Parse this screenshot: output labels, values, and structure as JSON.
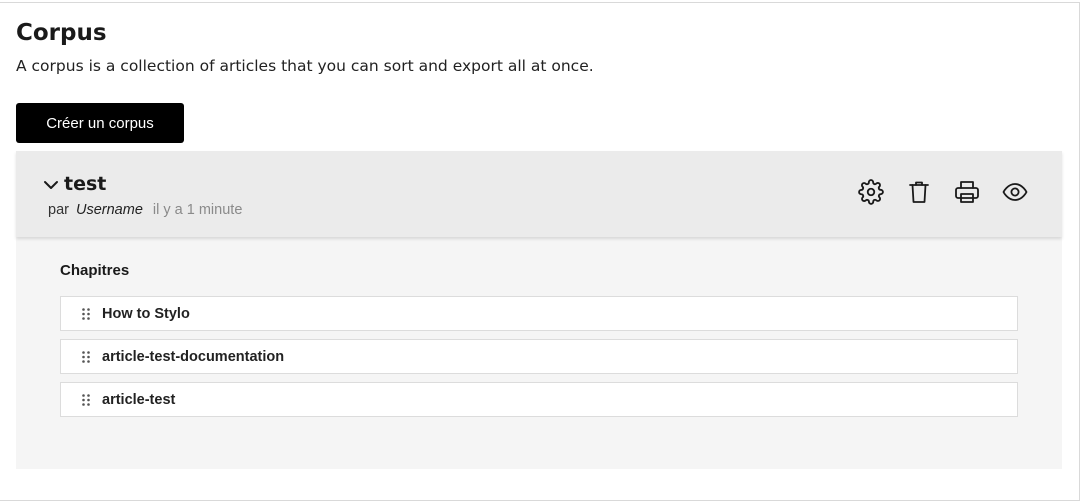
{
  "page": {
    "title": "Corpus",
    "description": "A corpus is a collection of articles that you can sort and export all at once."
  },
  "toolbar": {
    "create_label": "Créer un corpus"
  },
  "corpus": {
    "name": "test",
    "by_label": "par",
    "author": "Username",
    "updated": "il y a 1 minute",
    "actions": [
      "settings",
      "delete",
      "print",
      "preview"
    ],
    "section_title": "Chapitres",
    "chapters": [
      {
        "label": "How to Stylo"
      },
      {
        "label": "article-test-documentation"
      },
      {
        "label": "article-test"
      }
    ]
  }
}
